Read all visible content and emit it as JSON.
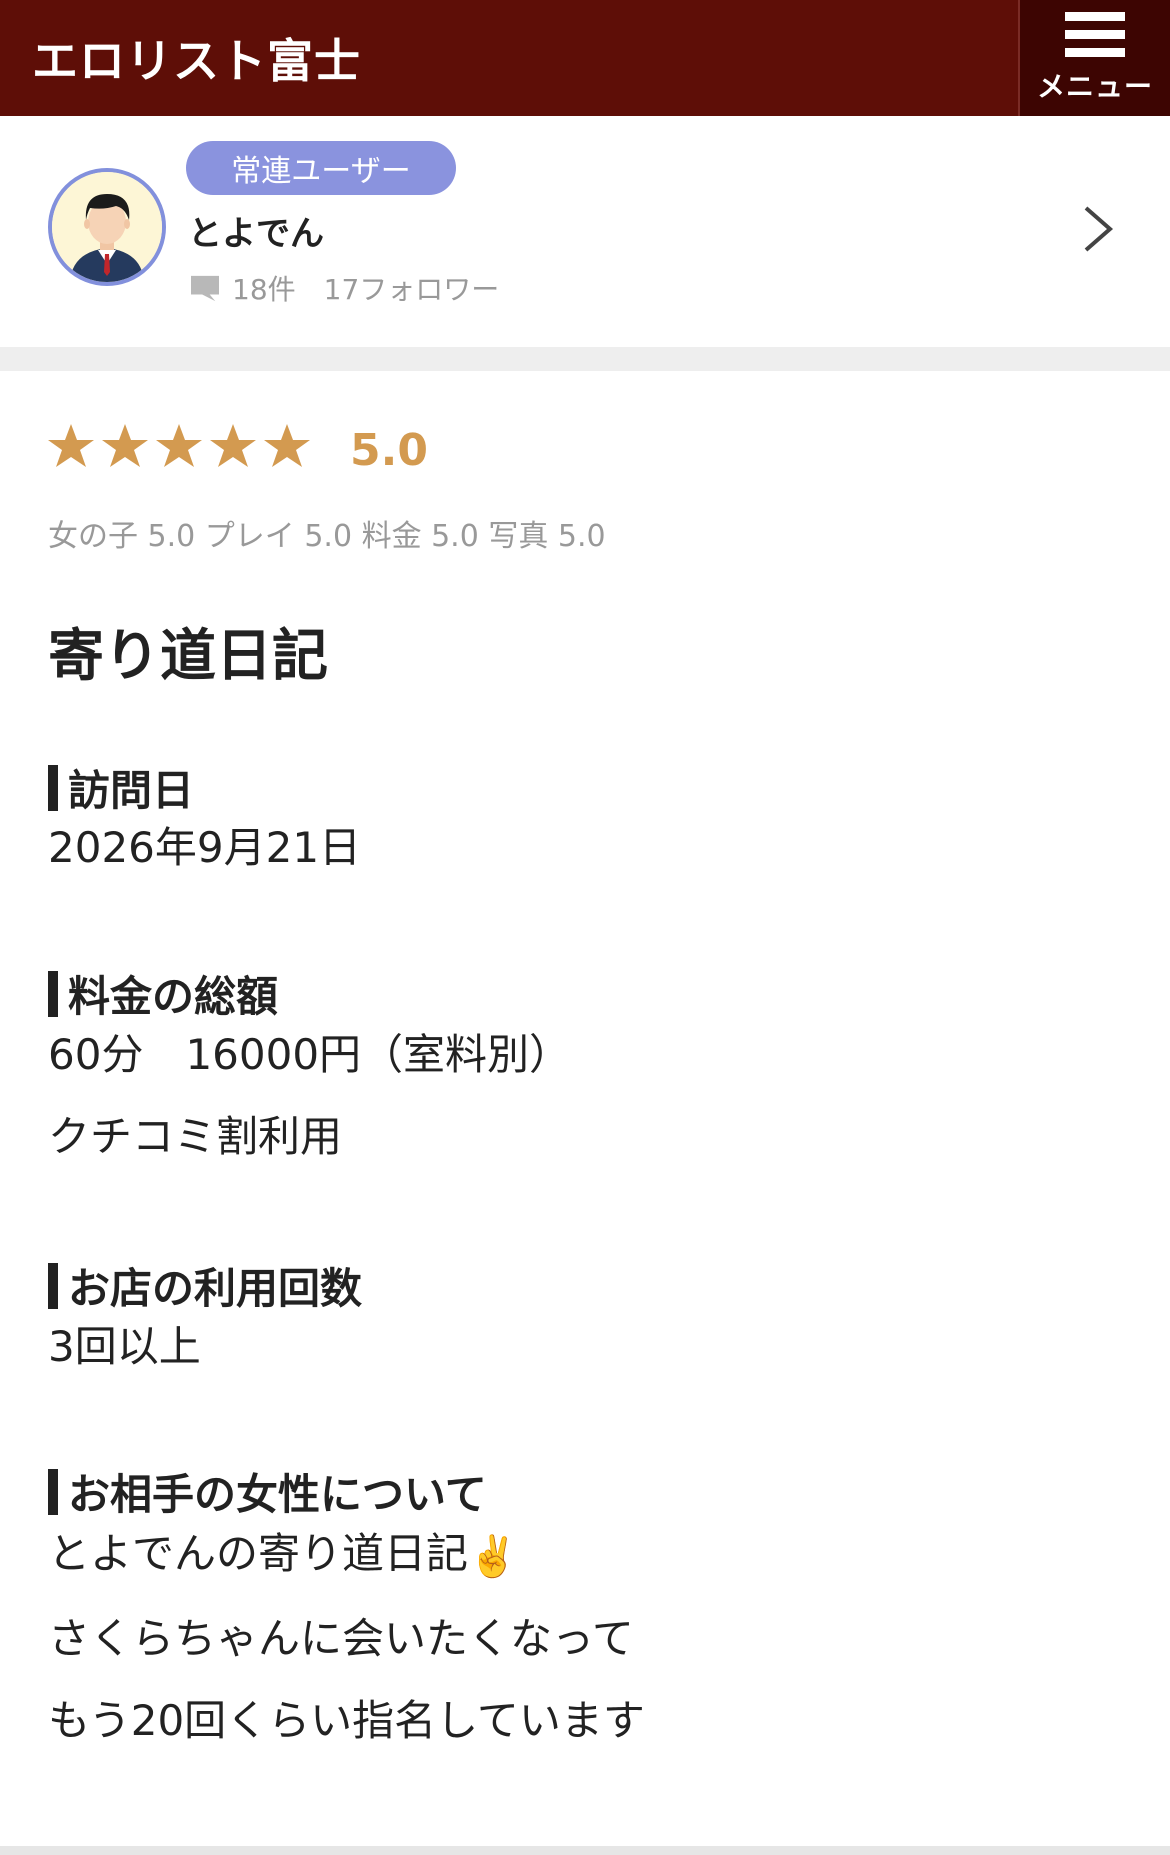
{
  "header": {
    "site_title": "エロリスト富士",
    "menu_label": "メニュー"
  },
  "user": {
    "badge": "常連ユーザー",
    "name": "とよでん",
    "stats": "18件　17フォロワー"
  },
  "review": {
    "rating": "5.0",
    "stars": 5,
    "subratings": "女の子 5.0 プレイ 5.0 料金 5.0 写真 5.0",
    "title": "寄り道日記",
    "sections": {
      "visit_date": {
        "heading": "訪問日",
        "lines": [
          "2026年9月21日"
        ]
      },
      "price": {
        "heading": "料金の総額",
        "lines": [
          "60分　16000円（室料別）",
          "クチコミ割利用"
        ]
      },
      "visits": {
        "heading": "お店の利用回数",
        "lines": [
          "3回以上"
        ]
      },
      "about": {
        "heading": "お相手の女性について",
        "lines": [
          "とよでんの寄り道日記",
          "さくらちゃんに会いたくなって",
          "もう20回くらい指名しています"
        ],
        "emoji": "✌️"
      }
    }
  },
  "colors": {
    "header_bg": "#5e0e07",
    "menu_bg": "#3d0502",
    "badge_bg": "#8a93de",
    "star": "#d39a50",
    "avatar_border": "#8290dc"
  },
  "icons": {
    "menu": "hamburger-icon",
    "comment": "comment-icon",
    "chevron": "chevron-right-icon",
    "star": "star-icon"
  }
}
